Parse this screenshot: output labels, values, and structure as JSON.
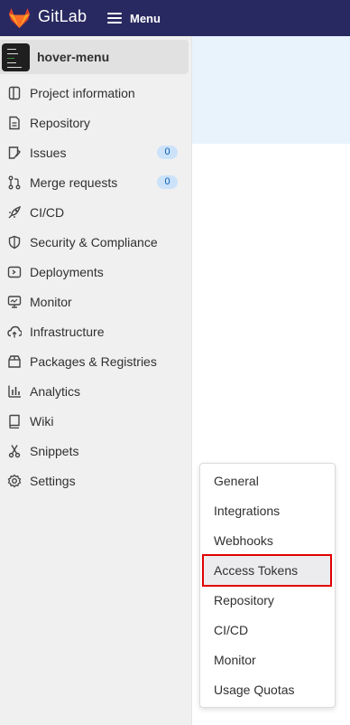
{
  "topbar": {
    "brand": "GitLab",
    "menu_label": "Menu"
  },
  "project": {
    "name": "hover-menu",
    "avatar_lines": [
      "HOME",
      "ABOUT",
      "BLOG",
      "TEAM",
      "CONTACT"
    ]
  },
  "sidebar": {
    "items": [
      {
        "label": "Project information",
        "icon": "info-icon"
      },
      {
        "label": "Repository",
        "icon": "document-icon"
      },
      {
        "label": "Issues",
        "icon": "issues-icon",
        "badge": "0"
      },
      {
        "label": "Merge requests",
        "icon": "merge-request-icon",
        "badge": "0"
      },
      {
        "label": "CI/CD",
        "icon": "rocket-icon"
      },
      {
        "label": "Security & Compliance",
        "icon": "shield-icon"
      },
      {
        "label": "Deployments",
        "icon": "deployments-icon"
      },
      {
        "label": "Monitor",
        "icon": "monitor-icon"
      },
      {
        "label": "Infrastructure",
        "icon": "cloud-icon"
      },
      {
        "label": "Packages & Registries",
        "icon": "package-icon"
      },
      {
        "label": "Analytics",
        "icon": "chart-icon"
      },
      {
        "label": "Wiki",
        "icon": "book-icon"
      },
      {
        "label": "Snippets",
        "icon": "scissors-icon"
      },
      {
        "label": "Settings",
        "icon": "gear-icon"
      }
    ]
  },
  "settings_flyout": {
    "items": [
      "General",
      "Integrations",
      "Webhooks",
      "Access Tokens",
      "Repository",
      "CI/CD",
      "Monitor",
      "Usage Quotas"
    ],
    "highlighted": "Access Tokens"
  },
  "colors": {
    "topbar": "#292961",
    "sidebar": "#f0f0f0",
    "badge_bg": "#cbe2f9",
    "highlight_border": "#e00000"
  }
}
